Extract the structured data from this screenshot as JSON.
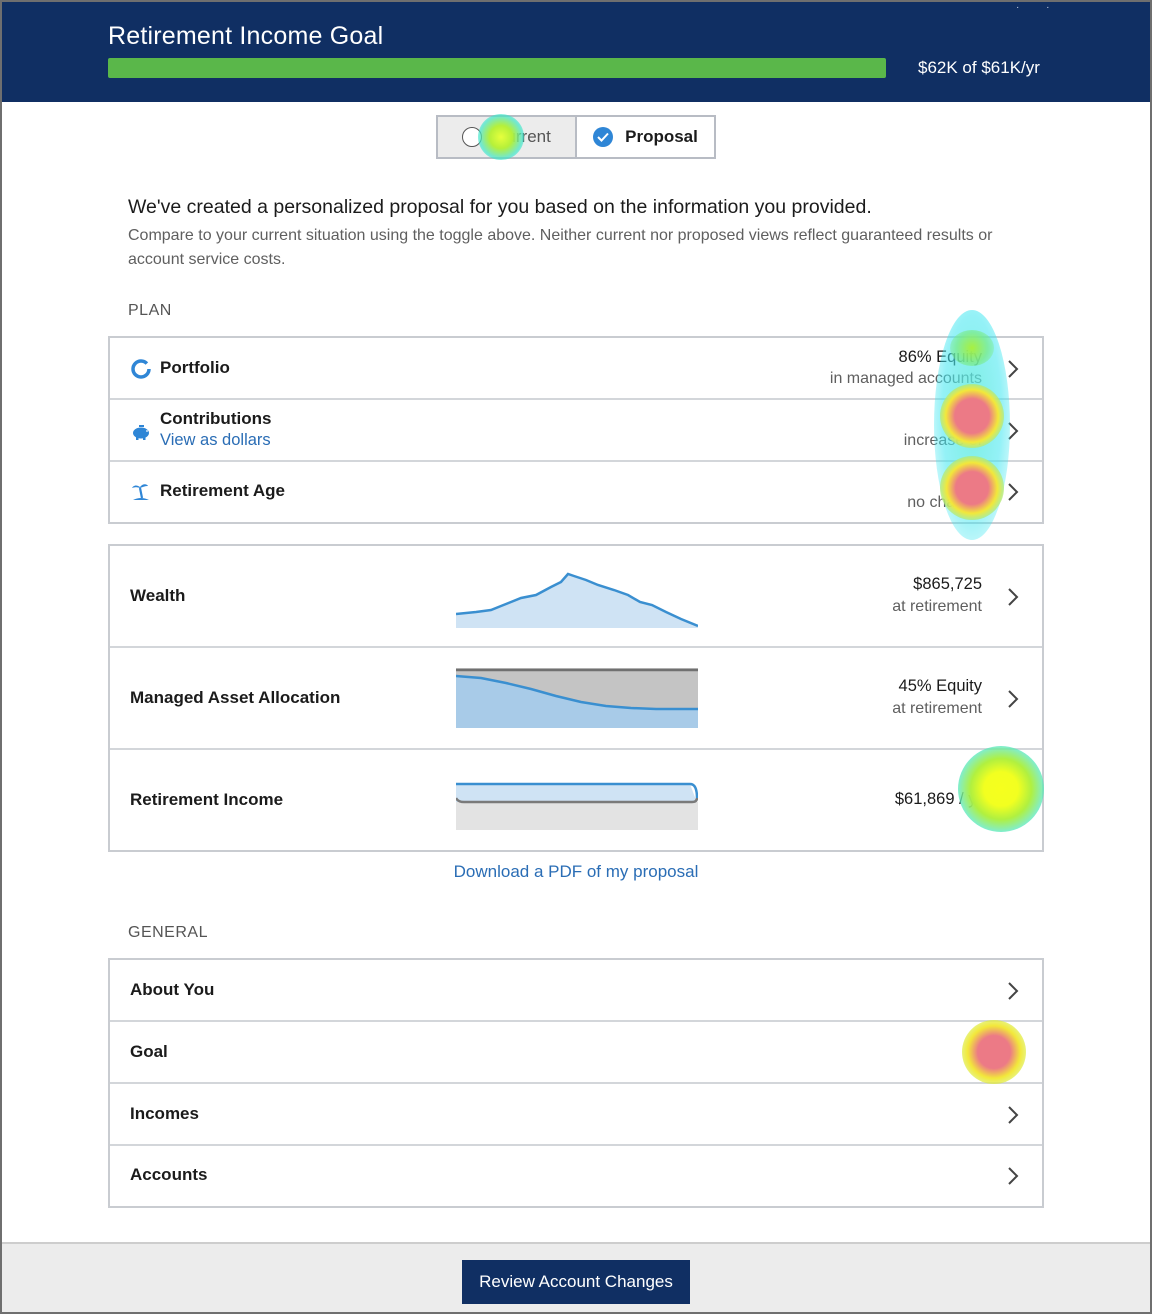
{
  "header": {
    "title": "Retirement Income Goal",
    "progress_fraction": 1.0,
    "progress_text": "$62K of $61K/yr",
    "bar_color": "#5ab74a",
    "background": "#102f63"
  },
  "toggle": {
    "current_label": "Current",
    "proposal_label": "Proposal",
    "selected": "Proposal"
  },
  "intro": {
    "heading": "We've created a personalized proposal for you based on the information you provided.",
    "subtext": "Compare to your current situation using the toggle above. Neither current nor proposed views reflect guaranteed results or account service costs."
  },
  "plan": {
    "section_label": "PLAN",
    "items": [
      {
        "label": "Portfolio",
        "icon": "donut-icon",
        "value": "86% Equity",
        "value_sub": "in managed accounts"
      },
      {
        "label": "Contributions",
        "icon": "piggy-bank-icon",
        "link": "View as dollars",
        "value": "11%",
        "value_sub": "increase of"
      },
      {
        "label": "Retirement Age",
        "icon": "palm-tree-icon",
        "value": "",
        "value_sub": "no change"
      }
    ]
  },
  "projections": [
    {
      "label": "Wealth",
      "value": "$865,725",
      "value_sub": "at retirement",
      "chart": "wealth-sparkline"
    },
    {
      "label": "Managed Asset Allocation",
      "value": "45% Equity",
      "value_sub": "at retirement",
      "chart": "allocation-sparkline"
    },
    {
      "label": "Retirement Income",
      "value": "$61,869 / yr",
      "value_sub": "",
      "chart": "income-sparkline"
    }
  ],
  "download_link": "Download a PDF of my proposal",
  "general": {
    "section_label": "GENERAL",
    "items": [
      {
        "label": "About You"
      },
      {
        "label": "Goal"
      },
      {
        "label": "Incomes"
      },
      {
        "label": "Accounts"
      }
    ]
  },
  "footer": {
    "button_label": "Review Account Changes"
  },
  "colors": {
    "accent": "#2f86d6",
    "link": "#2a6db5",
    "chart_fill": "#cfe3f4",
    "chart_line": "#3a8fd0",
    "chart_gray": "#c4c4c4"
  }
}
